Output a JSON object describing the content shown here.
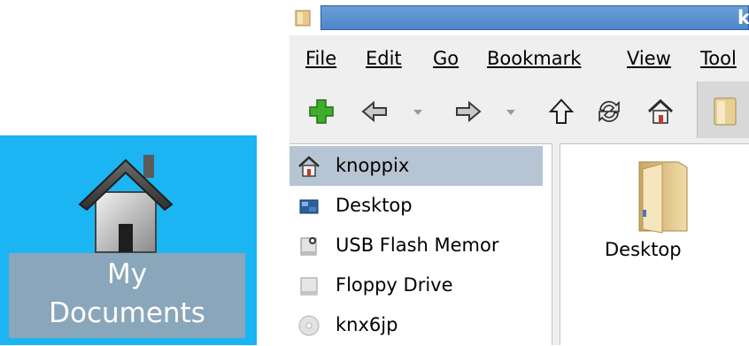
{
  "desktop_icon": {
    "label_line1": "My",
    "label_line2": "Documents",
    "icon": "home-icon"
  },
  "window": {
    "title_fragment": "k",
    "menu": [
      "File",
      "Edit",
      "Go",
      "Bookmark",
      "View",
      "Tool"
    ],
    "toolbar": [
      "new-tab-icon",
      "back-icon",
      "forward-icon",
      "up-icon",
      "reload-icon",
      "home-icon",
      "folder-icon"
    ],
    "sidebar": [
      {
        "label": "knoppix",
        "icon": "home-icon",
        "selected": true
      },
      {
        "label": "Desktop",
        "icon": "desktop-icon",
        "selected": false
      },
      {
        "label": "USB Flash Memor",
        "icon": "usb-drive-icon",
        "selected": false
      },
      {
        "label": "Floppy Drive",
        "icon": "floppy-drive-icon",
        "selected": false
      },
      {
        "label": "knx6jp",
        "icon": "cd-icon",
        "selected": false
      }
    ],
    "content": {
      "items": [
        {
          "label": "Desktop",
          "icon": "folder-icon"
        }
      ]
    }
  },
  "colors": {
    "desktop_bg": "#1ab5f2",
    "label_bg": "#8aa6bb",
    "titlebar": "#5a90cf",
    "selection": "#b7c4d3"
  }
}
